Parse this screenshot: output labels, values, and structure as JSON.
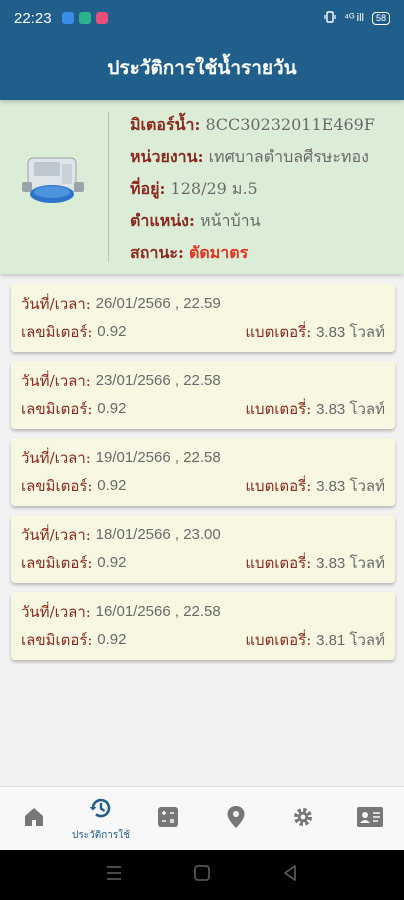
{
  "status_bar": {
    "time": "22:23",
    "network": "⁴ᴳ ill",
    "battery": "58",
    "notification_colors": [
      "#3a8ee6",
      "#2bb38a",
      "#e84d7c"
    ]
  },
  "header": {
    "title": "ประวัติการใช้น้ำรายวัน"
  },
  "meter": {
    "meter_label": "มิเตอร์น้ำ:",
    "meter_value": "8CC30232011E469F",
    "agency_label": "หน่วยงาน:",
    "agency_value": "เทศบาลตำบลศีรษะทอง",
    "address_label": "ที่อยู่:",
    "address_value": "128/29 ม.5",
    "position_label": "ตำแหน่ง:",
    "position_value": "หน้าบ้าน",
    "status_label": "สถานะ:",
    "status_value": "ตัดมาตร",
    "status_color": "#e03424"
  },
  "record_labels": {
    "datetime": "วันที่/เวลา:",
    "meter_reading": "เลขมิเตอร์:",
    "battery": "แบตเตอรี่:"
  },
  "records": [
    {
      "datetime": "26/01/2566 , 22.59",
      "reading": "0.92",
      "battery": "3.83 โวลท์"
    },
    {
      "datetime": "23/01/2566 , 22.58",
      "reading": "0.92",
      "battery": "3.83 โวลท์"
    },
    {
      "datetime": "19/01/2566 , 22.58",
      "reading": "0.92",
      "battery": "3.83 โวลท์"
    },
    {
      "datetime": "18/01/2566 , 23.00",
      "reading": "0.92",
      "battery": "3.83 โวลท์"
    },
    {
      "datetime": "16/01/2566 , 22.58",
      "reading": "0.92",
      "battery": "3.81 โวลท์"
    }
  ],
  "bottom_nav": [
    {
      "icon": "home-icon",
      "label": ""
    },
    {
      "icon": "history-icon",
      "label": "ประวัติการใช้",
      "active": true
    },
    {
      "icon": "calculator-icon",
      "label": ""
    },
    {
      "icon": "location-pin-icon",
      "label": ""
    },
    {
      "icon": "gear-icon",
      "label": ""
    },
    {
      "icon": "contact-card-icon",
      "label": ""
    }
  ],
  "colors": {
    "primary": "#205f8c",
    "label": "#8b2a1f",
    "card_bg": "#f8f8e2",
    "meter_bg": "#dcedd7"
  }
}
